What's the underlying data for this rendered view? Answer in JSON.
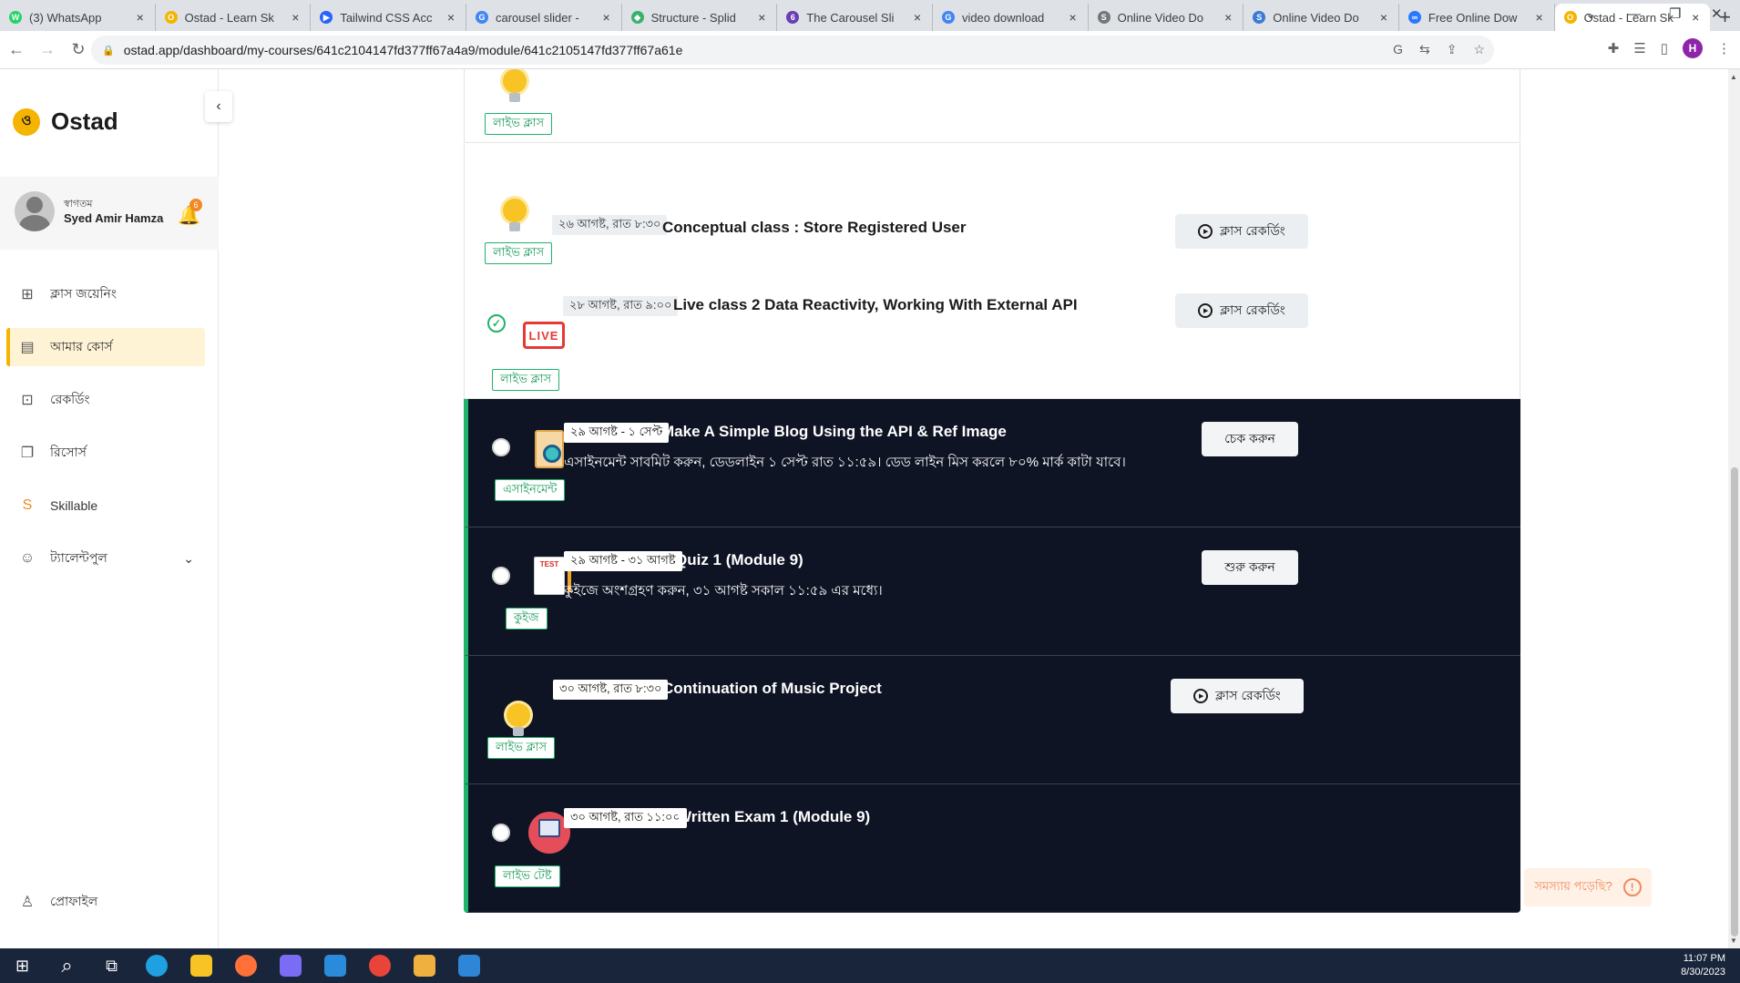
{
  "browser": {
    "tabs": [
      {
        "title": "(3) WhatsApp",
        "fav": "whatsapp-icon",
        "color": "#25d366",
        "glyph": "W"
      },
      {
        "title": "Ostad - Learn Sk",
        "fav": "ostad-icon",
        "color": "#f5b400",
        "glyph": "O"
      },
      {
        "title": "Tailwind CSS Acc",
        "fav": "play-icon",
        "color": "#2962ff",
        "glyph": "▶"
      },
      {
        "title": "carousel slider -",
        "fav": "google-icon",
        "color": "#4285f4",
        "glyph": "G"
      },
      {
        "title": "Structure - Splid",
        "fav": "splide-icon",
        "color": "#38b26b",
        "glyph": "◆"
      },
      {
        "title": "The Carousel Sli",
        "fav": "letter-6-icon",
        "color": "#6a3fb5",
        "glyph": "6"
      },
      {
        "title": "video download",
        "fav": "google-icon",
        "color": "#4285f4",
        "glyph": "G"
      },
      {
        "title": "Online Video Do",
        "fav": "sst-icon",
        "color": "#777777",
        "glyph": "S"
      },
      {
        "title": "Online Video Do",
        "fav": "s-icon",
        "color": "#3a7bd5",
        "glyph": "S"
      },
      {
        "title": "Free Online Dow",
        "fav": "infinity-icon",
        "color": "#2979ff",
        "glyph": "∞"
      },
      {
        "title": "Ostad - Learn Sk",
        "fav": "ostad-icon",
        "color": "#f5b400",
        "glyph": "O",
        "active": true
      }
    ],
    "url": "ostad.app/dashboard/my-courses/641c2104147fd377ff67a4a9/module/641c2105147fd377ff67a61e",
    "profile_initial": "H"
  },
  "sidebar": {
    "brand": "Ostad",
    "greeting": "স্বাগতম",
    "user_name": "Syed Amir Hamza",
    "notif_count": "6",
    "items": [
      {
        "label": "ক্লাস জয়েনিং",
        "icon": "grid-icon",
        "glyph": "⊞"
      },
      {
        "label": "আমার কোর্স",
        "icon": "book-icon",
        "glyph": "▤",
        "active": true
      },
      {
        "label": "রেকর্ডিং",
        "icon": "video-icon",
        "glyph": "⊡"
      },
      {
        "label": "রিসোর্স",
        "icon": "copy-icon",
        "glyph": "❐"
      },
      {
        "label": "Skillable",
        "icon": "skillable-icon",
        "glyph": "S"
      },
      {
        "label": "ট্যালেন্টপুল",
        "icon": "user-star-icon",
        "glyph": "☺",
        "chevron": "⌄"
      }
    ],
    "profile_label": "প্রোফাইল"
  },
  "rows": [
    {
      "type": "live",
      "tag": "লাইভ ক্লাস",
      "date": "",
      "title": "",
      "button": ""
    },
    {
      "type": "live",
      "tag": "লাইভ ক্লাস",
      "date": "২৬ আগষ্ট, রাত ৮:৩০",
      "title": "Conceptual class : Store Registered User",
      "button": "ক্লাস রেকর্ডিং"
    },
    {
      "type": "live-done",
      "tag": "লাইভ ক্লাস",
      "icon_text": "LIVE",
      "date": "২৮ আগষ্ট, রাত ৯:০০",
      "title": "Live class 2  Data Reactivity, Working With External API",
      "button": "ক্লাস রেকর্ডিং"
    },
    {
      "type": "assignment",
      "tag": "এসাইনমেন্ট",
      "date": "২৯ আগষ্ট - ১ সেপ্ট",
      "title": "Make A Simple Blog Using the API & Ref Image",
      "desc": "এসাইনমেন্ট সাবমিট করুন, ডেডলাইন ১ সেপ্ট রাত ১১:৫৯। ডেড লাইন মিস করলে ৮০% মার্ক কাটা যাবে।",
      "button": "চেক করুন"
    },
    {
      "type": "quiz",
      "tag": "কুইজ",
      "icon_text": "TEST",
      "date": "২৯ আগষ্ট - ৩১ আগষ্ট",
      "title": "Quiz 1 (Module 9)",
      "desc": "কুইজে অংশগ্রহণ করুন, ৩১ আগষ্ট সকাল ১১:৫৯ এর মধ্যে।",
      "button": "শুরু করুন"
    },
    {
      "type": "live-dark",
      "tag": "লাইভ ক্লাস",
      "date": "৩০ আগষ্ট, রাত ৮:৩০",
      "title": "Continuation of Music Project",
      "button": "ক্লাস রেকর্ডিং"
    },
    {
      "type": "exam",
      "tag": "লাইভ টেষ্ট",
      "date": "৩০ আগষ্ট, রাত ১১:০০",
      "title": "Written Exam 1 (Module 9)",
      "button": ""
    }
  ],
  "help": {
    "label": "সমস্যায় পড়েছি?",
    "glyph": "!"
  },
  "taskbar": {
    "time": "11:07 PM",
    "date": "8/30/2023",
    "apps": [
      {
        "name": "windows-start-icon",
        "color": "#ffffff"
      },
      {
        "name": "search-icon",
        "color": "#ffffff"
      },
      {
        "name": "task-view-icon",
        "color": "#ffffff"
      },
      {
        "name": "edge-icon",
        "color": "#1fa0e0"
      },
      {
        "name": "file-explorer-icon",
        "color": "#f7c325"
      },
      {
        "name": "firefox-icon",
        "color": "#ff7139"
      },
      {
        "name": "app-icon",
        "color": "#7b6cf6"
      },
      {
        "name": "vscode-icon",
        "color": "#2b8bdb"
      },
      {
        "name": "chrome-icon",
        "color": "#e9443a"
      },
      {
        "name": "git-icon",
        "color": "#f0b03f"
      },
      {
        "name": "photos-icon",
        "color": "#2f86d6"
      }
    ]
  },
  "colors": {
    "accent": "#f5b400",
    "green": "#1fb36b",
    "dark_row": "#0f1424"
  }
}
